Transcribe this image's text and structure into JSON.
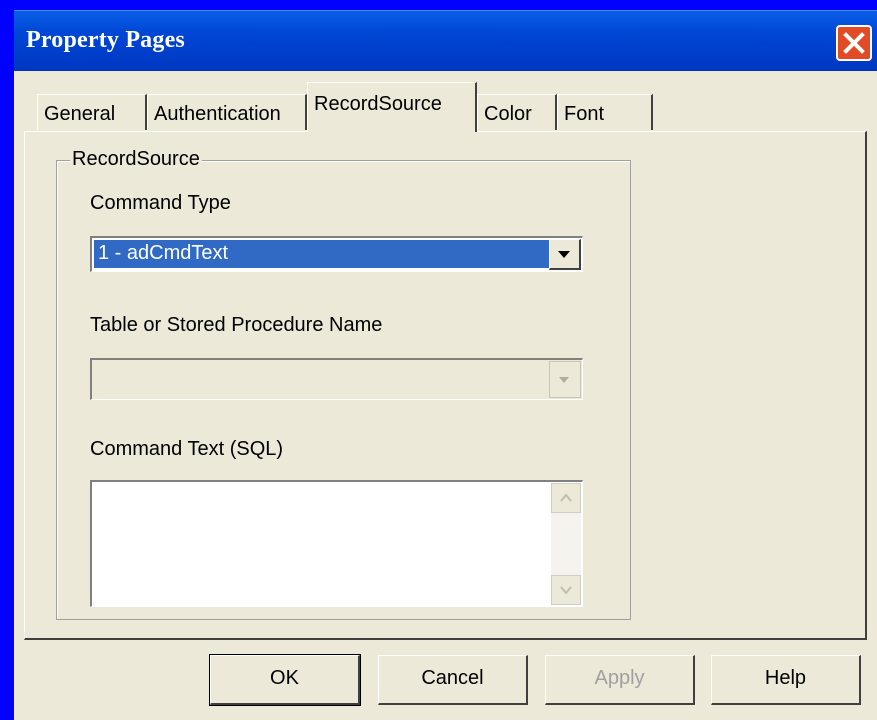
{
  "window": {
    "title": "Property Pages"
  },
  "tabs": [
    {
      "label": "General"
    },
    {
      "label": "Authentication"
    },
    {
      "label": "RecordSource",
      "active": true
    },
    {
      "label": "Color"
    },
    {
      "label": "Font"
    }
  ],
  "recordsource": {
    "group_label": "RecordSource",
    "command_type_label": "Command Type",
    "command_type_value": "1 - adCmdText",
    "table_label": "Table or Stored Procedure Name",
    "table_value": "",
    "command_text_label": "Command Text (SQL)",
    "command_text_value": ""
  },
  "buttons": {
    "ok": "OK",
    "cancel": "Cancel",
    "apply": "Apply",
    "help": "Help"
  },
  "colors": {
    "desktop": "#0000ff",
    "titlebar": "#0047d6",
    "close": "#e24b26",
    "dialog": "#ece9d8",
    "selection": "#316ac5"
  },
  "icons": {
    "close": "close-icon",
    "dropdown": "chevron-down-icon",
    "scroll_up": "scroll-up-arrow-icon",
    "scroll_down": "scroll-down-arrow-icon"
  }
}
